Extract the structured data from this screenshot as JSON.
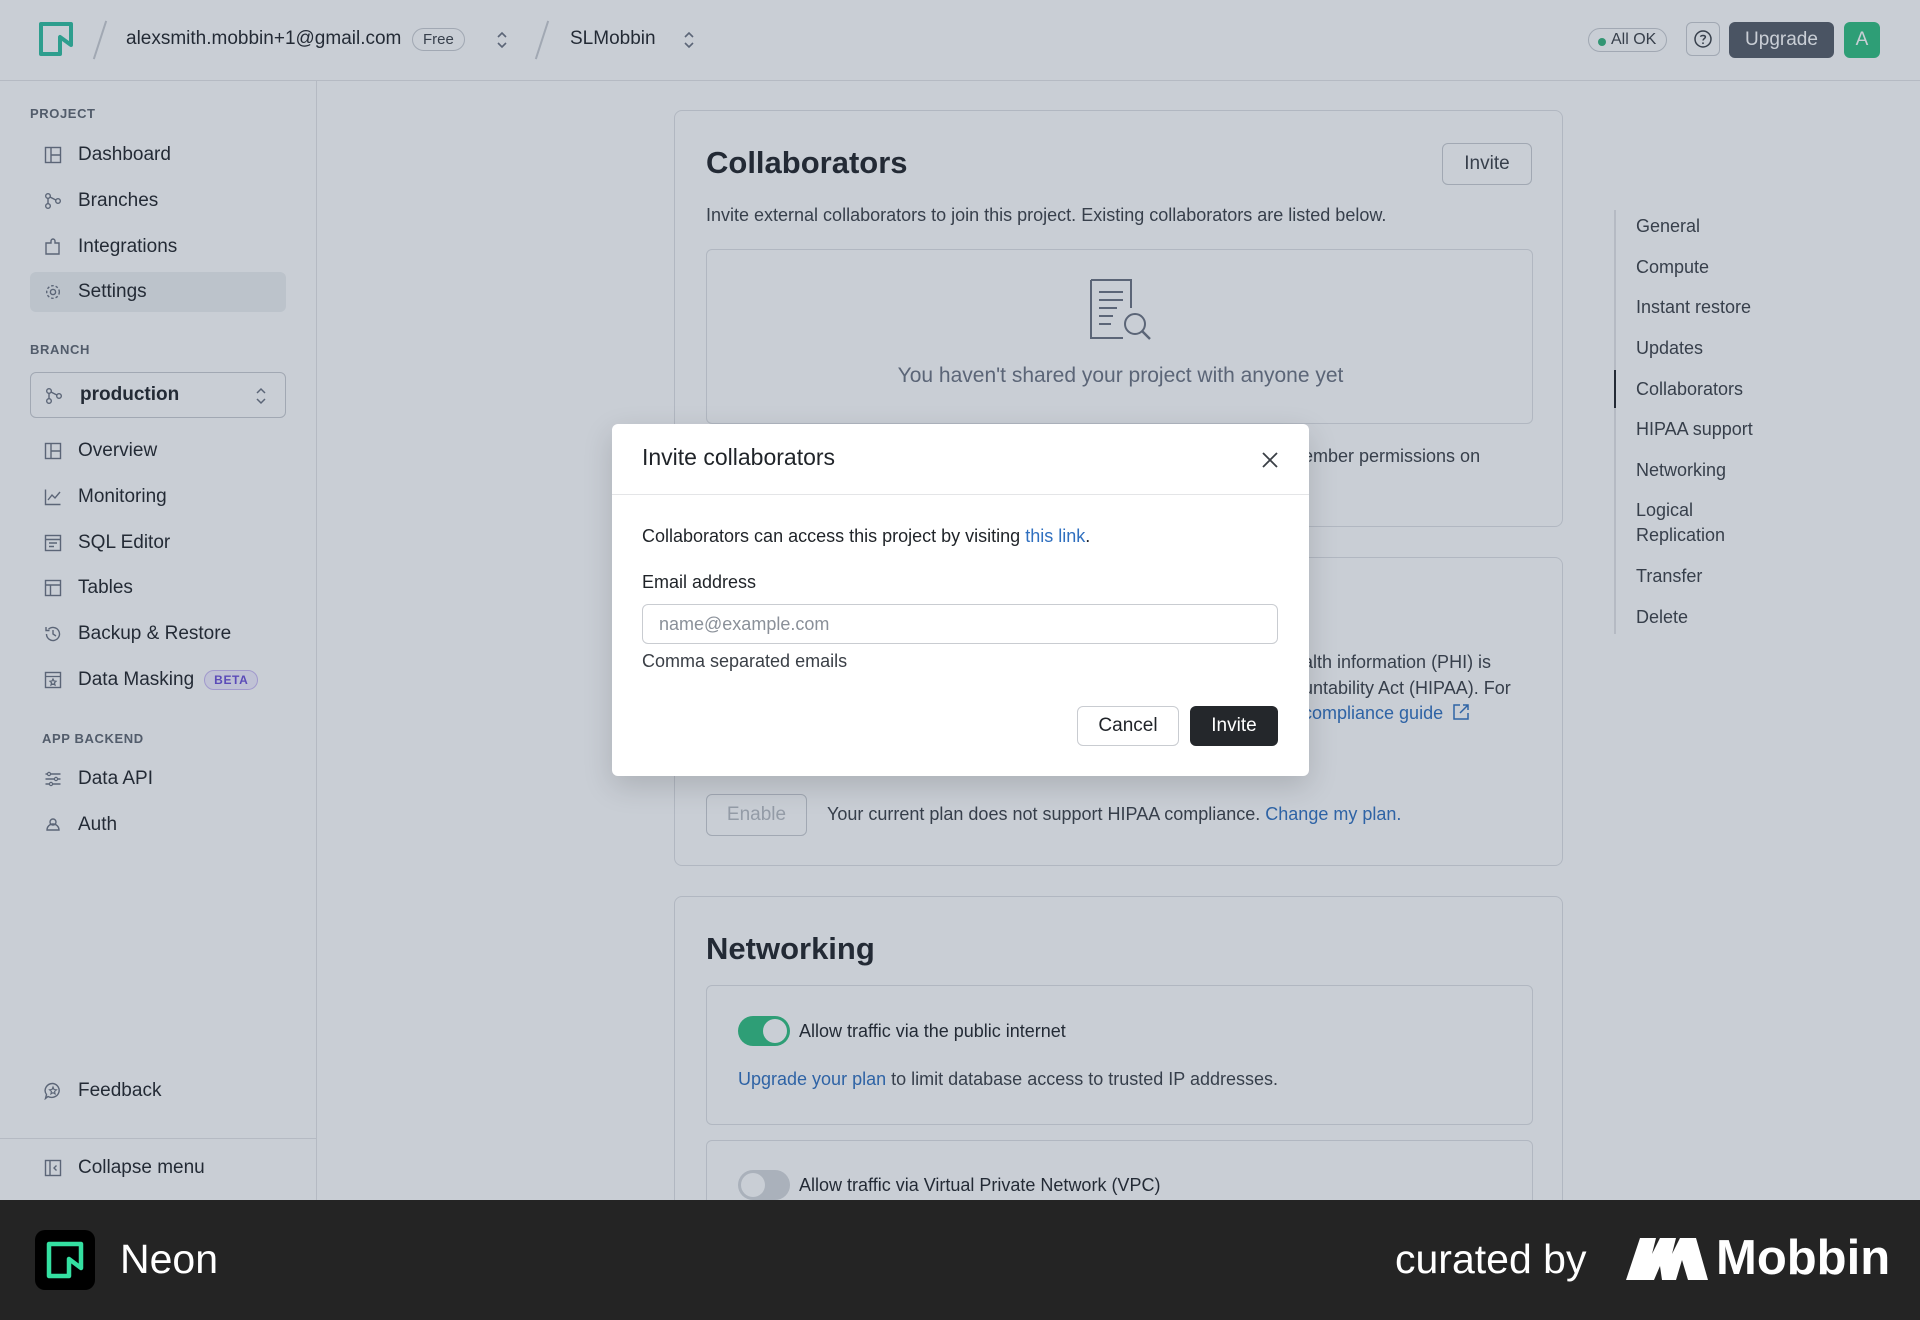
{
  "header": {
    "account_email": "alexsmith.mobbin+1@gmail.com",
    "plan_badge": "Free",
    "project_name": "SLMobbin",
    "status_label": "All OK",
    "upgrade_label": "Upgrade",
    "avatar_initial": "A"
  },
  "sidebar": {
    "project_section": "PROJECT",
    "project_items": [
      {
        "label": "Dashboard",
        "icon": "dashboard-icon"
      },
      {
        "label": "Branches",
        "icon": "branches-icon"
      },
      {
        "label": "Integrations",
        "icon": "integrations-icon"
      },
      {
        "label": "Settings",
        "icon": "gear-icon",
        "active": true
      }
    ],
    "branch_section": "BRANCH",
    "branch_selected": "production",
    "branch_items": [
      {
        "label": "Overview",
        "icon": "overview-icon"
      },
      {
        "label": "Monitoring",
        "icon": "chart-icon"
      },
      {
        "label": "SQL Editor",
        "icon": "sql-editor-icon"
      },
      {
        "label": "Tables",
        "icon": "table-icon"
      },
      {
        "label": "Backup & Restore",
        "icon": "history-icon"
      },
      {
        "label": "Data Masking",
        "icon": "mask-icon",
        "badge": "BETA"
      }
    ],
    "backend_section": "APP BACKEND",
    "backend_items": [
      {
        "label": "Data API",
        "icon": "api-icon"
      },
      {
        "label": "Auth",
        "icon": "auth-icon"
      }
    ],
    "feedback_label": "Feedback",
    "collapse_label": "Collapse menu"
  },
  "collaborators": {
    "title": "Collaborators",
    "invite_label": "Invite",
    "description": "Invite external collaborators to join this project. Existing collaborators are listed below.",
    "empty_text": "You haven't shared your project with anyone yet",
    "behind_text": "ember permissions on"
  },
  "hipaa": {
    "line1": "alth information (PHI) is",
    "line2": "untability Act (HIPAA). For",
    "link": "compliance guide",
    "enable_label": "Enable",
    "plan_text": "Your current plan does not support HIPAA compliance.",
    "plan_link": "Change my plan."
  },
  "networking": {
    "title": "Networking",
    "public_label": "Allow traffic via the public internet",
    "public_on": true,
    "upgrade_link": "Upgrade your plan",
    "upgrade_text": "to limit database access to trusted IP addresses.",
    "vpc_label": "Allow traffic via Virtual Private Network (VPC)",
    "vpc_on": false
  },
  "anchor_nav": {
    "items": [
      "General",
      "Compute",
      "Instant restore",
      "Updates",
      "Collaborators",
      "HIPAA support",
      "Networking",
      "Logical Replication",
      "Transfer",
      "Delete"
    ],
    "active": "Collaborators"
  },
  "modal": {
    "title": "Invite collaborators",
    "text_before": "Collaborators can access this project by visiting",
    "link_text": "this link",
    "text_after": ".",
    "email_label": "Email address",
    "email_placeholder": "name@example.com",
    "email_value": "",
    "hint": "Comma separated emails",
    "cancel_label": "Cancel",
    "invite_label": "Invite"
  },
  "footer": {
    "brand": "Neon",
    "curated_by": "curated by",
    "mobbin": "Mobbin"
  },
  "colors": {
    "accent_green": "#2fbf7f",
    "link_blue": "#2f6fbf",
    "primary_dark": "#24272b"
  }
}
